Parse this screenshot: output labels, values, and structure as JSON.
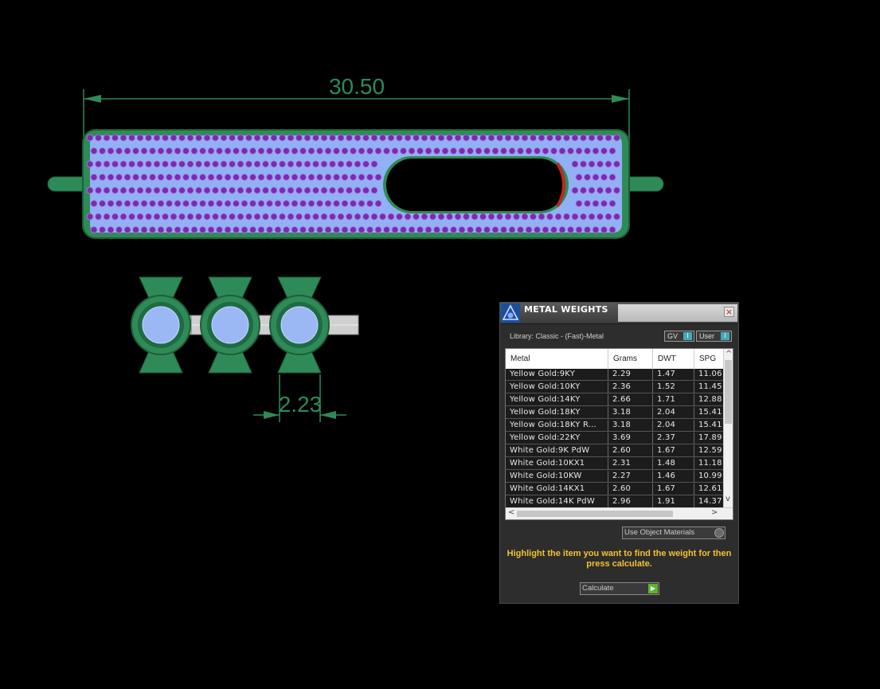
{
  "viewport": {
    "dimension_top": "30.50",
    "dimension_bottom": "2.23"
  },
  "panel": {
    "title": "METAL WEIGHTS",
    "close_glyph": "×",
    "library": "Library: Classic - (Fast)-Metal",
    "toggle_gv": "GV",
    "toggle_user": "User",
    "columns": [
      "Metal",
      "Grams",
      "DWT",
      "SPG"
    ],
    "rows": [
      [
        "Yellow Gold:9KY",
        "2.29",
        "1.47",
        "11.06"
      ],
      [
        "Yellow Gold:10KY",
        "2.36",
        "1.52",
        "11.45"
      ],
      [
        "Yellow Gold:14KY",
        "2.66",
        "1.71",
        "12.88"
      ],
      [
        "Yellow Gold:18KY",
        "3.18",
        "2.04",
        "15.41"
      ],
      [
        "Yellow Gold:18KY R...",
        "3.18",
        "2.04",
        "15.41"
      ],
      [
        "Yellow Gold:22KY",
        "3.69",
        "2.37",
        "17.89"
      ],
      [
        "White Gold:9K PdW",
        "2.60",
        "1.67",
        "12.59"
      ],
      [
        "White Gold:10KX1",
        "2.31",
        "1.48",
        "11.18"
      ],
      [
        "White Gold:10KW",
        "2.27",
        "1.46",
        "10.99"
      ],
      [
        "White Gold:14KX1",
        "2.60",
        "1.67",
        "12.61"
      ],
      [
        "White Gold:14K PdW",
        "2.96",
        "1.91",
        "14.37"
      ]
    ],
    "dropdown_value": "Use Object Materials",
    "help_text": "Highlight the item you want to find the weight for then press calculate.",
    "calculate_label": "Calculate",
    "icons": {
      "logo": "rhino-gemvision-logo-icon",
      "close": "close-icon",
      "scroll_up": "chevron-up-icon",
      "scroll_down": "chevron-down-icon",
      "scroll_left": "chevron-left-icon",
      "scroll_right": "chevron-right-icon",
      "go": "play-icon"
    }
  }
}
